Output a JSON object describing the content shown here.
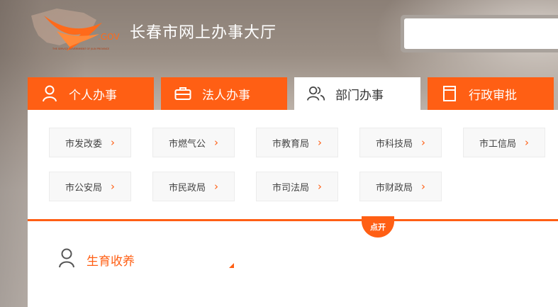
{
  "header": {
    "title": "长春市网上办事大厅",
    "logo_text": ".GOV",
    "logo_subtext": "THE SERVICE GOVERNMENT OF JILIN PROVINCE",
    "search": {
      "value": "",
      "placeholder": ""
    }
  },
  "tabs": [
    {
      "label": "个人办事",
      "icon": "person-icon",
      "active": false
    },
    {
      "label": "法人办事",
      "icon": "briefcase-icon",
      "active": false
    },
    {
      "label": "部门办事",
      "icon": "people-icon",
      "active": true
    },
    {
      "label": "行政审批",
      "icon": "document-icon",
      "active": false
    }
  ],
  "departments": [
    "市发改委",
    "市燃气公",
    "市教育局",
    "市科技局",
    "市工信局",
    "市公安局",
    "市民政局",
    "市司法局",
    "市财政局"
  ],
  "toggle_label": "点开",
  "category": {
    "label": "生育收养",
    "icon": "person-icon"
  },
  "colors": {
    "accent": "#ff5f14",
    "tile_bg": "#f8f8f8"
  }
}
